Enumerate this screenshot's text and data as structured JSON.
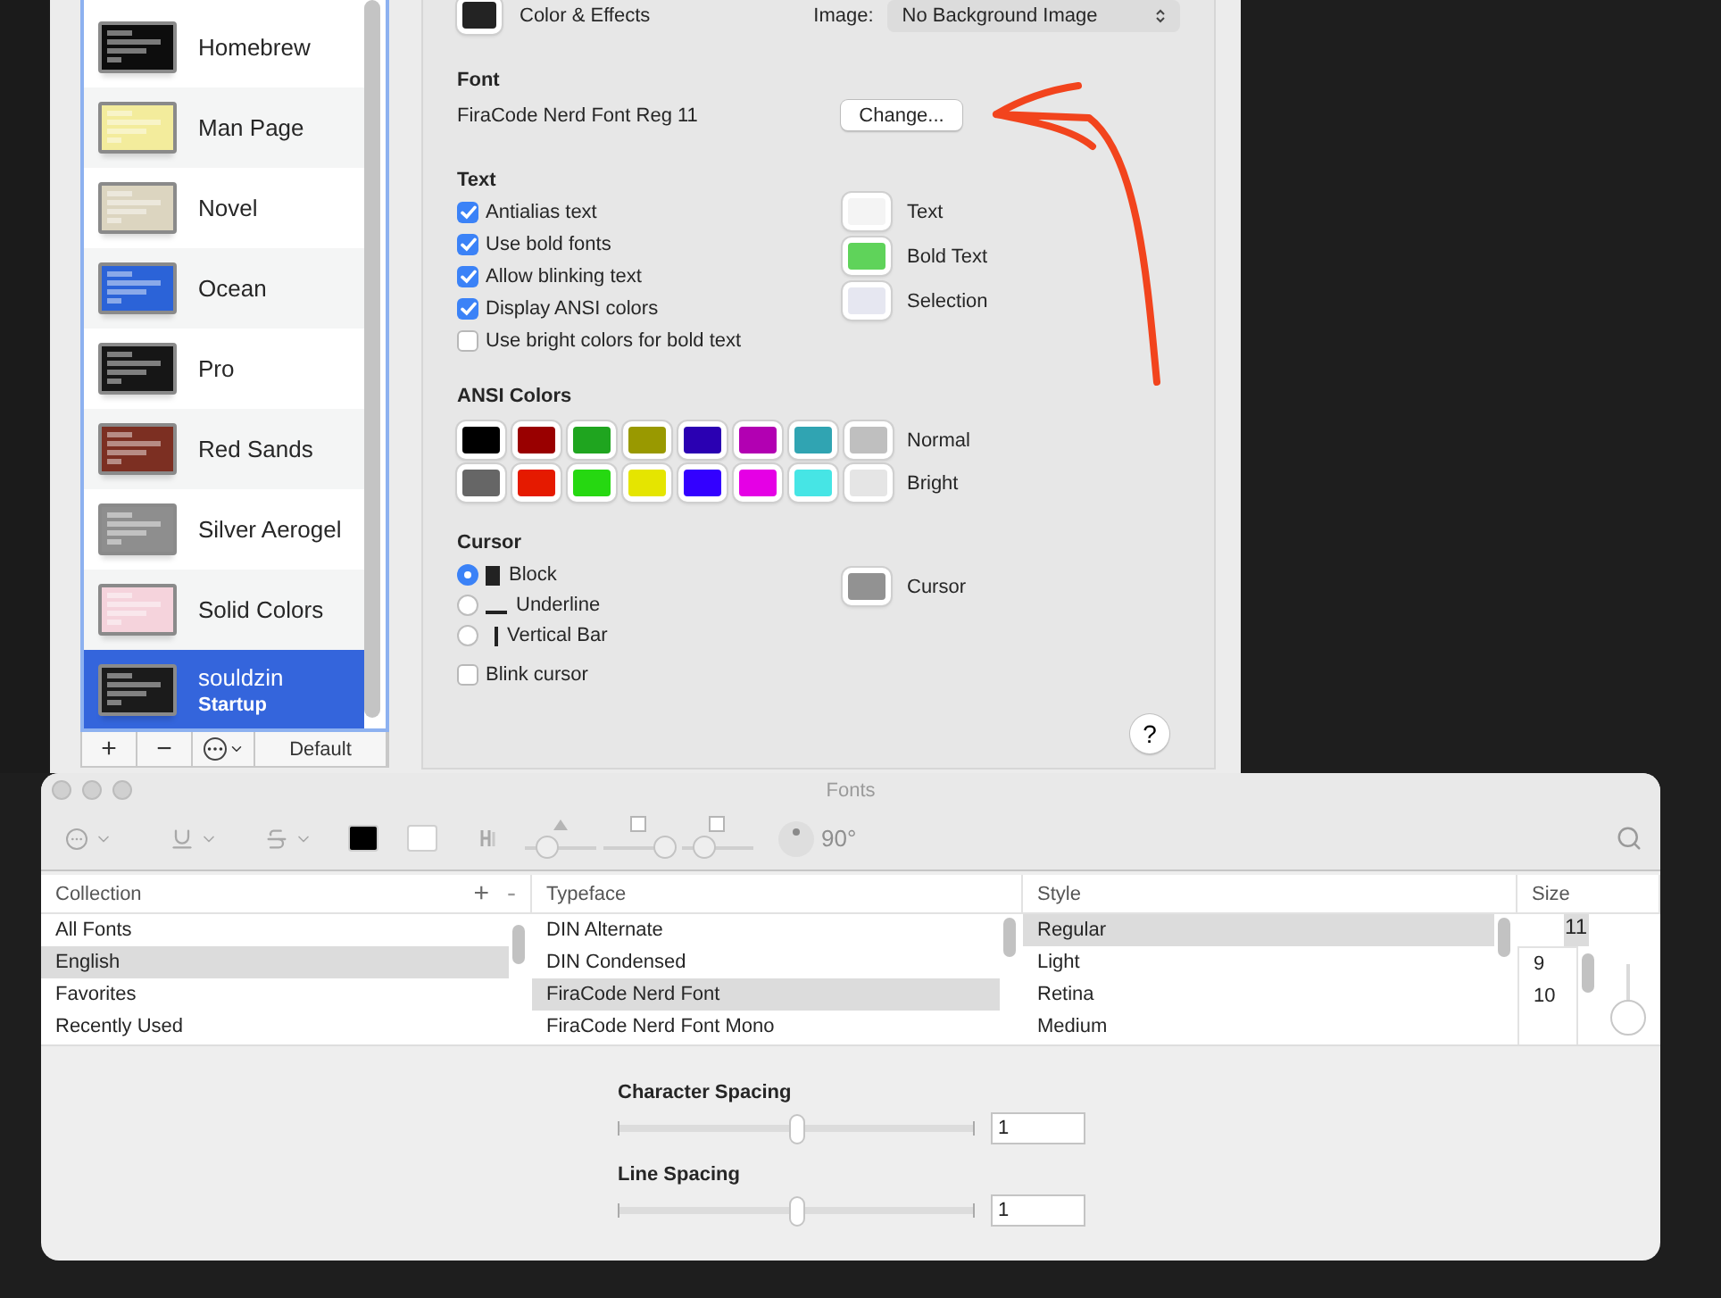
{
  "profiles": {
    "items": [
      {
        "name": "Homebrew",
        "color": "#0d0d0d",
        "selected": false
      },
      {
        "name": "Man Page",
        "color": "#f3ec9c",
        "selected": false
      },
      {
        "name": "Novel",
        "color": "#dcd5c0",
        "selected": false
      },
      {
        "name": "Ocean",
        "color": "#2b63d8",
        "selected": false
      },
      {
        "name": "Pro",
        "color": "#161616",
        "selected": false
      },
      {
        "name": "Red Sands",
        "color": "#7c2f22",
        "selected": false
      },
      {
        "name": "Silver Aerogel",
        "color": "#8e8e8e",
        "selected": false
      },
      {
        "name": "Solid Colors",
        "color": "#f5d3dc",
        "selected": false
      },
      {
        "name": "souldzin",
        "subtitle": "Startup",
        "color": "#1b1b1b",
        "selected": true
      }
    ],
    "add": "+",
    "remove": "−",
    "default": "Default"
  },
  "settings": {
    "background": {
      "label": "Color & Effects",
      "color": "#232323",
      "image_label": "Image:",
      "image_value": "No Background Image"
    },
    "font": {
      "heading": "Font",
      "name": "FiraCode Nerd Font Reg 11",
      "button": "Change..."
    },
    "text": {
      "heading": "Text",
      "options": [
        {
          "label": "Antialias text",
          "checked": true
        },
        {
          "label": "Use bold fonts",
          "checked": true
        },
        {
          "label": "Allow blinking text",
          "checked": true
        },
        {
          "label": "Display ANSI colors",
          "checked": true
        },
        {
          "label": "Use bright colors for bold text",
          "checked": false
        }
      ],
      "colors": [
        {
          "label": "Text",
          "color": "#f4f4f4"
        },
        {
          "label": "Bold Text",
          "color": "#5fd35a"
        },
        {
          "label": "Selection",
          "color": "#e6e7f1"
        }
      ]
    },
    "ansi": {
      "heading": "ANSI Colors",
      "rows": [
        {
          "label": "Normal",
          "colors": [
            {
              "color": "#000000"
            },
            {
              "color": "#990000"
            },
            {
              "color": "#1fa51f"
            },
            {
              "color": "#999900"
            },
            {
              "color": "#2a00b2"
            },
            {
              "color": "#b200b2"
            },
            {
              "color": "#30a4b2"
            },
            {
              "color": "#bfbfbf"
            }
          ]
        },
        {
          "label": "Bright",
          "colors": [
            {
              "color": "#666666"
            },
            {
              "color": "#e51a00"
            },
            {
              "color": "#26d811"
            },
            {
              "color": "#e5e500"
            },
            {
              "color": "#3300ff"
            },
            {
              "color": "#e500e5"
            },
            {
              "color": "#46e5e5"
            },
            {
              "color": "#e5e5e5"
            }
          ]
        }
      ]
    },
    "cursor": {
      "heading": "Cursor",
      "options": [
        {
          "label": "Block",
          "kind": "block",
          "selected": true
        },
        {
          "label": "Underline",
          "kind": "underline",
          "selected": false
        },
        {
          "label": "Vertical Bar",
          "kind": "bar",
          "selected": false
        }
      ],
      "color": {
        "label": "Cursor",
        "color": "#929292"
      },
      "blink": {
        "label": "Blink cursor",
        "checked": false
      }
    },
    "help": "?"
  },
  "fonts_window": {
    "title": "Fonts",
    "color_wells": [
      {
        "color": "#000000"
      },
      {
        "color": "#ffffff"
      }
    ],
    "toolbar_sliders": [
      {
        "kind": "triangle",
        "level": 0.3
      },
      {
        "kind": "square",
        "level": 0.85
      },
      {
        "kind": "square",
        "level": 0.3
      }
    ],
    "angle": "90°",
    "collection": {
      "heading": "Collection",
      "add": "+",
      "remove": "-",
      "items": [
        {
          "label": "All Fonts",
          "selected": false
        },
        {
          "label": "English",
          "selected": true
        },
        {
          "label": "Favorites",
          "selected": false
        },
        {
          "label": "Recently Used",
          "selected": false
        }
      ]
    },
    "typeface": {
      "heading": "Typeface",
      "items": [
        {
          "label": "DIN Alternate",
          "selected": false
        },
        {
          "label": "DIN Condensed",
          "selected": false
        },
        {
          "label": "FiraCode Nerd Font",
          "selected": true
        },
        {
          "label": "FiraCode Nerd Font Mono",
          "selected": false
        }
      ]
    },
    "style": {
      "heading": "Style",
      "items": [
        {
          "label": "Regular",
          "selected": true
        },
        {
          "label": "Light",
          "selected": false
        },
        {
          "label": "Retina",
          "selected": false
        },
        {
          "label": "Medium",
          "selected": false
        }
      ]
    },
    "size": {
      "heading": "Size",
      "value": "11",
      "items": [
        {
          "label": "9"
        },
        {
          "label": "10"
        }
      ],
      "level": 0.05
    },
    "spacing": [
      {
        "label": "Character Spacing",
        "level": 0.5,
        "value": "1"
      },
      {
        "label": "Line Spacing",
        "level": 0.5,
        "value": "1"
      }
    ]
  }
}
